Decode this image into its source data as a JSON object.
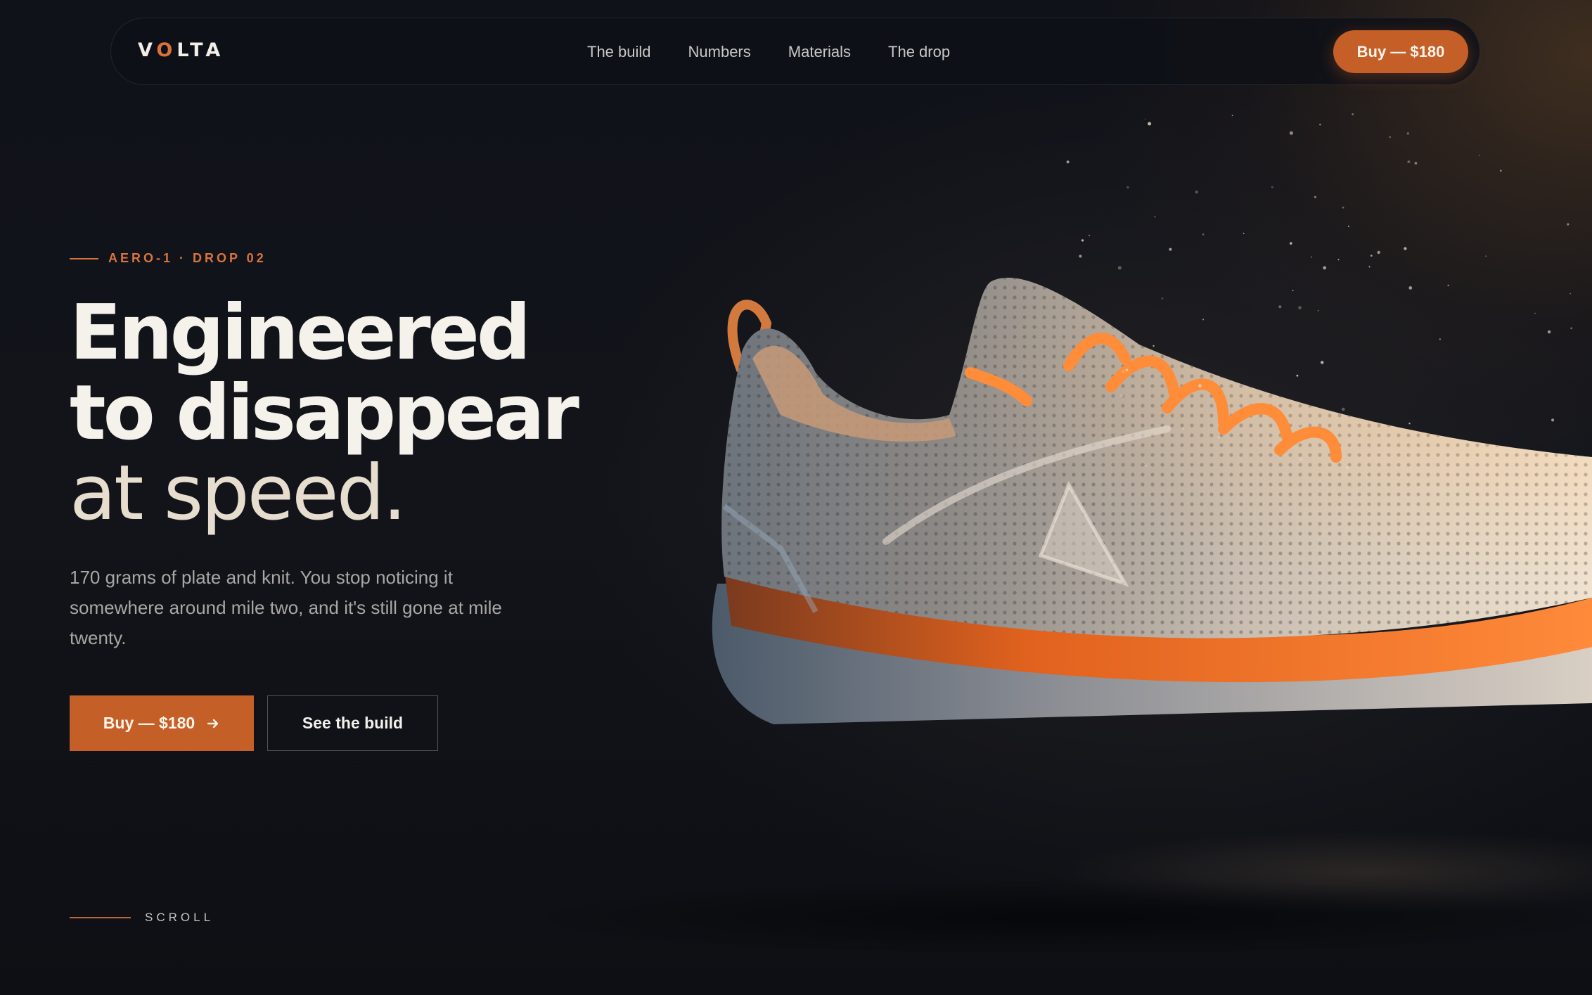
{
  "nav": {
    "logo_prefix": "V",
    "logo_accent": "O",
    "logo_suffix": "LTA",
    "links": [
      "The build",
      "Numbers",
      "Materials",
      "The drop"
    ],
    "cta_label": "Buy — $180"
  },
  "hero": {
    "eyebrow": "AERO-1 · DROP 02",
    "headline_line1": "Engineered",
    "headline_line2": "to disappear",
    "headline_line3": "at speed.",
    "subtext": "170 grams of plate and knit. You stop noticing it somewhere around mile two, and it's still gone at mile twenty.",
    "primary_cta": "Buy — $180",
    "primary_cta_icon": "arrow-right-icon",
    "secondary_cta": "See the build",
    "scroll_label": "SCROLL"
  },
  "colors": {
    "background": "#0f1116",
    "accent": "#c45f27",
    "accent_text": "#d9713a",
    "headline": "#f5f2ec",
    "body_text": "#a9a7a4"
  }
}
